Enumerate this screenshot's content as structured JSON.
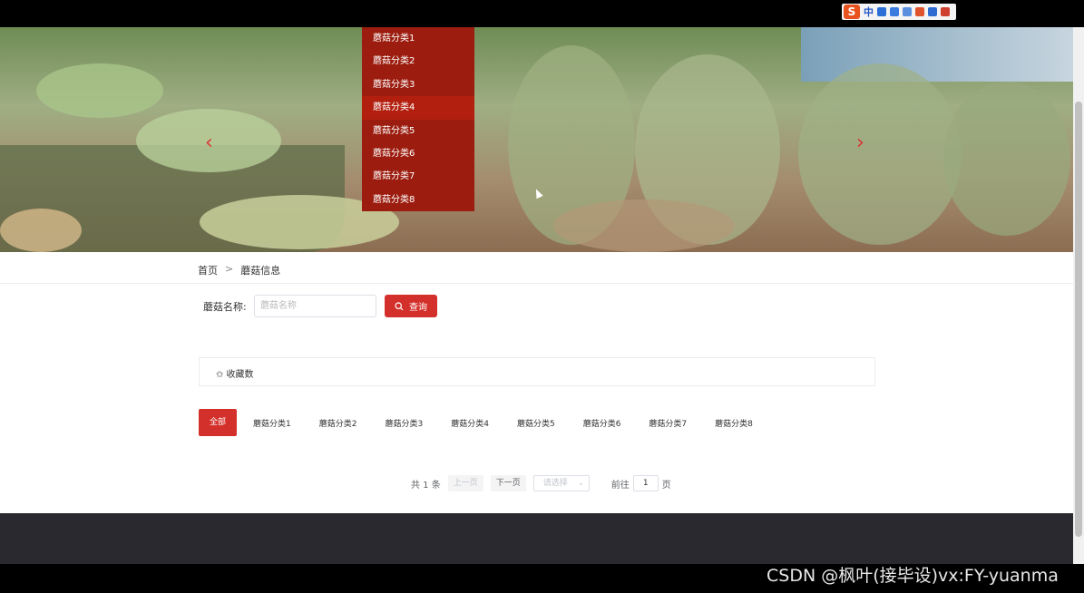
{
  "ime": {
    "logo": "S",
    "mode": "中"
  },
  "banner": {
    "prev_arrow": "‹",
    "next_arrow": "›"
  },
  "dropdown": {
    "items": [
      "蘑菇分类1",
      "蘑菇分类2",
      "蘑菇分类3",
      "蘑菇分类4",
      "蘑菇分类5",
      "蘑菇分类6",
      "蘑菇分类7",
      "蘑菇分类8"
    ],
    "active_index": 3
  },
  "breadcrumb": {
    "home": "首页",
    "separator": ">",
    "current": "蘑菇信息"
  },
  "search": {
    "label": "蘑菇名称:",
    "placeholder": "蘑菇名称",
    "button": "查询"
  },
  "sort": {
    "label": "✩ 收藏数"
  },
  "tabs": [
    "全部",
    "蘑菇分类1",
    "蘑菇分类2",
    "蘑菇分类3",
    "蘑菇分类4",
    "蘑菇分类5",
    "蘑菇分类6",
    "蘑菇分类7",
    "蘑菇分类8"
  ],
  "pager": {
    "total": "共 1 条",
    "prev": "上一页",
    "next": "下一页",
    "size_placeholder": "请选择",
    "goto": "前往",
    "page": "1",
    "page_unit": "页"
  },
  "watermark": "CSDN @枫叶(接毕设)vx:FY-yuanma",
  "colors": {
    "accent": "#d4302b",
    "dropdown": "#9c1d0f",
    "footer": "#2b2930"
  }
}
